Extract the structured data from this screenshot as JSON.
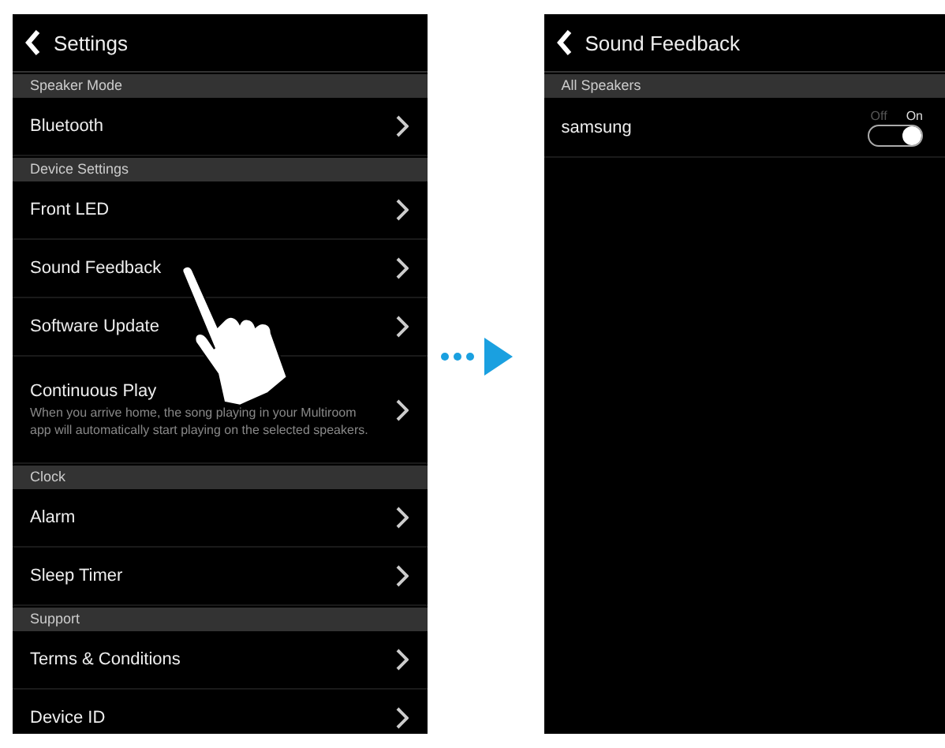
{
  "settings_screen": {
    "title": "Settings",
    "sections": [
      {
        "header": "Speaker Mode",
        "items": [
          {
            "label": "Bluetooth"
          }
        ]
      },
      {
        "header": "Device Settings",
        "items": [
          {
            "label": "Front LED"
          },
          {
            "label": "Sound Feedback"
          },
          {
            "label": "Software Update"
          },
          {
            "label": "Continuous Play",
            "description": "When you arrive home, the song playing in your Multiroom app will automatically start playing on the selected speakers."
          }
        ]
      },
      {
        "header": "Clock",
        "items": [
          {
            "label": "Alarm"
          },
          {
            "label": "Sleep Timer"
          }
        ]
      },
      {
        "header": "Support",
        "items": [
          {
            "label": "Terms & Conditions"
          },
          {
            "label": "Device ID"
          }
        ]
      }
    ]
  },
  "sound_feedback_screen": {
    "title": "Sound Feedback",
    "section": "All Speakers",
    "speakers": [
      {
        "name": "samsung",
        "off_label": "Off",
        "on_label": "On",
        "on": true
      }
    ]
  }
}
